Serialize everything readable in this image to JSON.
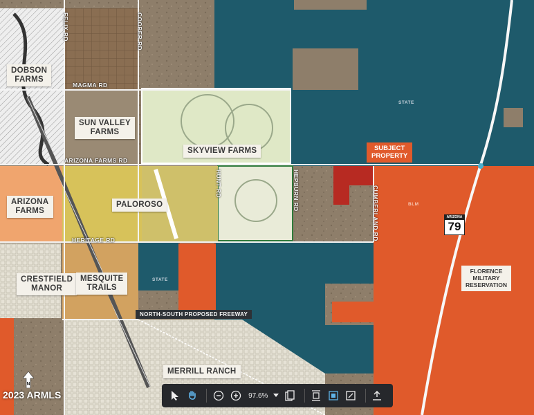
{
  "map": {
    "communities": {
      "dobson": "DOBSON\nFARMS",
      "sun_valley": "SUN VALLEY\nFARMS",
      "skyview": "SKYVIEW FARMS",
      "arizona_farms": "ARIZONA\nFARMS",
      "paloroso": "PALOROSO",
      "crestfield": "CRESTFIELD\nMANOR",
      "mesquite": "MESQUITE\nTRAILS",
      "merrill": "MERRILL RANCH"
    },
    "roads": {
      "felix": "FELIX RD",
      "cooper": "COOPER RD",
      "magma": "MAGMA RD",
      "arizona_farms_rd": "ARIZONA FARMS RD",
      "heritage": "HERITAGE RD",
      "hunt": "HUNT RD",
      "hepburn": "HEPBURN RD",
      "cumberland": "CUMBERLAND RD"
    },
    "agencies": {
      "state_1": "STATE",
      "state_2": "STATE",
      "blm": "BLM"
    },
    "subject_property": "SUBJECT\nPROPERTY",
    "florence_military": "FLORENCE\nMILITARY\nRESERVATION",
    "freeway": "NORTH-SOUTH  PROPOSED FREEWAY",
    "highway": {
      "state": "ARIZONA",
      "number": "79"
    },
    "watermark": "2023 ARMLS",
    "colors": {
      "state_land": "#1e5a6b",
      "blm_land": "#e05a2b",
      "subject": "#e05a2b",
      "desert": "#8a7a66"
    }
  },
  "toolbar": {
    "zoom": "97.6%",
    "icons": [
      "pointer-icon",
      "hand-icon",
      "zoom-out-icon",
      "zoom-in-icon",
      "zoom-dropdown-icon",
      "page-icon",
      "fit-height-icon",
      "fit-width-icon",
      "fit-page-icon",
      "share-icon"
    ]
  }
}
